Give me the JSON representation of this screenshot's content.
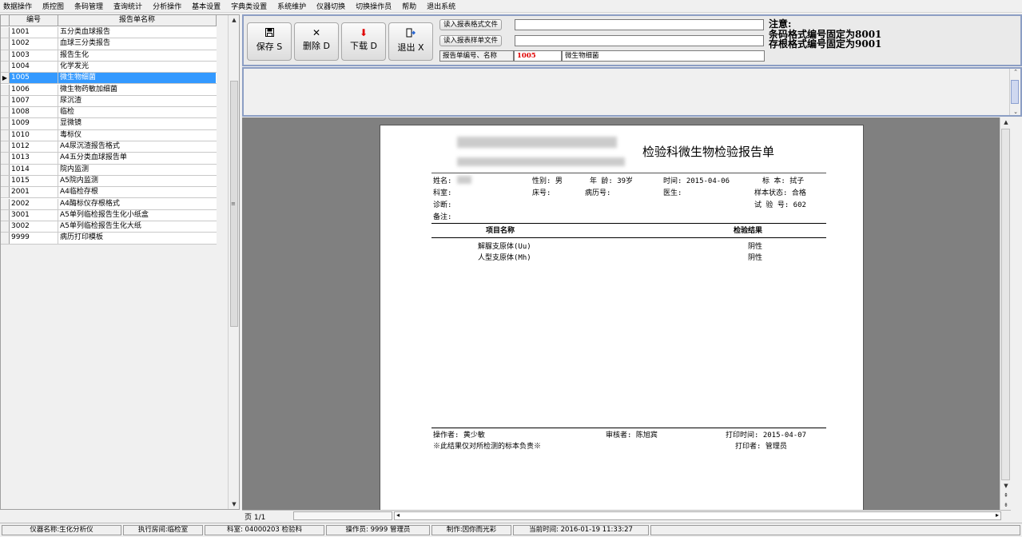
{
  "menu": [
    "数据操作",
    "质控图",
    "条码管理",
    "查询统计",
    "分析操作",
    "基本设置",
    "字典类设置",
    "系统维护",
    "仪器切换",
    "切换操作员",
    "帮助",
    "退出系统"
  ],
  "grid": {
    "headers": [
      "编号",
      "报告单名称"
    ],
    "rows": [
      {
        "code": "1001",
        "name": "五分类血球报告"
      },
      {
        "code": "1002",
        "name": "血球三分类报告"
      },
      {
        "code": "1003",
        "name": "报告生化"
      },
      {
        "code": "1004",
        "name": "化学发光"
      },
      {
        "code": "1005",
        "name": "微生物细菌",
        "selected": true
      },
      {
        "code": "1006",
        "name": "微生物药敏加细菌"
      },
      {
        "code": "1007",
        "name": "尿沉渣"
      },
      {
        "code": "1008",
        "name": "临检"
      },
      {
        "code": "1009",
        "name": "显微镜"
      },
      {
        "code": "1010",
        "name": "毒标仪"
      },
      {
        "code": "1012",
        "name": "A4尿沉渣报告格式"
      },
      {
        "code": "1013",
        "name": "A4五分类血球报告单"
      },
      {
        "code": "1014",
        "name": "院内监测"
      },
      {
        "code": "1015",
        "name": "A5院内监测"
      },
      {
        "code": "2001",
        "name": "A4临检存根"
      },
      {
        "code": "2002",
        "name": "A4酶标仪存根格式"
      },
      {
        "code": "3001",
        "name": "A5单列临检报告生化小纸盒"
      },
      {
        "code": "3002",
        "name": "A5单列临检报告生化大纸"
      },
      {
        "code": "9999",
        "name": "病历打印模板"
      }
    ]
  },
  "toolbar": {
    "save": {
      "icon": "save-icon",
      "label": "保存 S"
    },
    "delete": {
      "icon": "delete-icon",
      "label": "删除 D"
    },
    "download": {
      "icon": "download-icon",
      "label": "下载 D"
    },
    "exit": {
      "icon": "exit-icon",
      "label": "退出 X"
    },
    "read_format": "读入报表格式文件",
    "read_sample": "读入报表样单文件",
    "format_path": "",
    "sample_path": "",
    "report_label": "报告单编号、名称",
    "report_code": "1005",
    "report_name": "微生物细菌",
    "note1": "注意:",
    "note2": "条码格式编号固定为8001",
    "note3": "存根格式编号固定为9001"
  },
  "report": {
    "title": "检验科微生物检验报告单",
    "name_label": "姓名:",
    "sex": "性别: 男",
    "age": "年 龄: 39岁",
    "time": "时间: 2015-04-06",
    "specimen": "标  本: 拭子",
    "dept": "科室:",
    "bed": "床号:",
    "record": "病历号:",
    "doctor": "医生:",
    "specimen_state": "样本状态: 合格",
    "diagnosis": "诊断:",
    "test_no": "试 验 号: 602",
    "remark": "备注:",
    "col_item": "项目名称",
    "col_result": "检验结果",
    "items": [
      {
        "name": "解脲支原体(Uu)",
        "result": "阴性"
      },
      {
        "name": "人型支原体(Mh)",
        "result": "阴性"
      }
    ],
    "operator": "操作者: 黄少敏",
    "reviewer": "审核者: 陈旭宾",
    "print_time": "打印时间: 2015-04-07",
    "disclaimer": "※此结果仅对所检测的标本负责※",
    "printer": "打印者: 管理员"
  },
  "pager": "页 1/1",
  "status": {
    "instrument": "仪器名称:生化分析仪",
    "room": "执行房间:临检室",
    "dept": "科室: 04000203 检验科",
    "operator": "操作员: 9999 管理员",
    "maker": "制作:因你而光彩",
    "time": "当前时间: 2016-01-19 11:33:27"
  }
}
